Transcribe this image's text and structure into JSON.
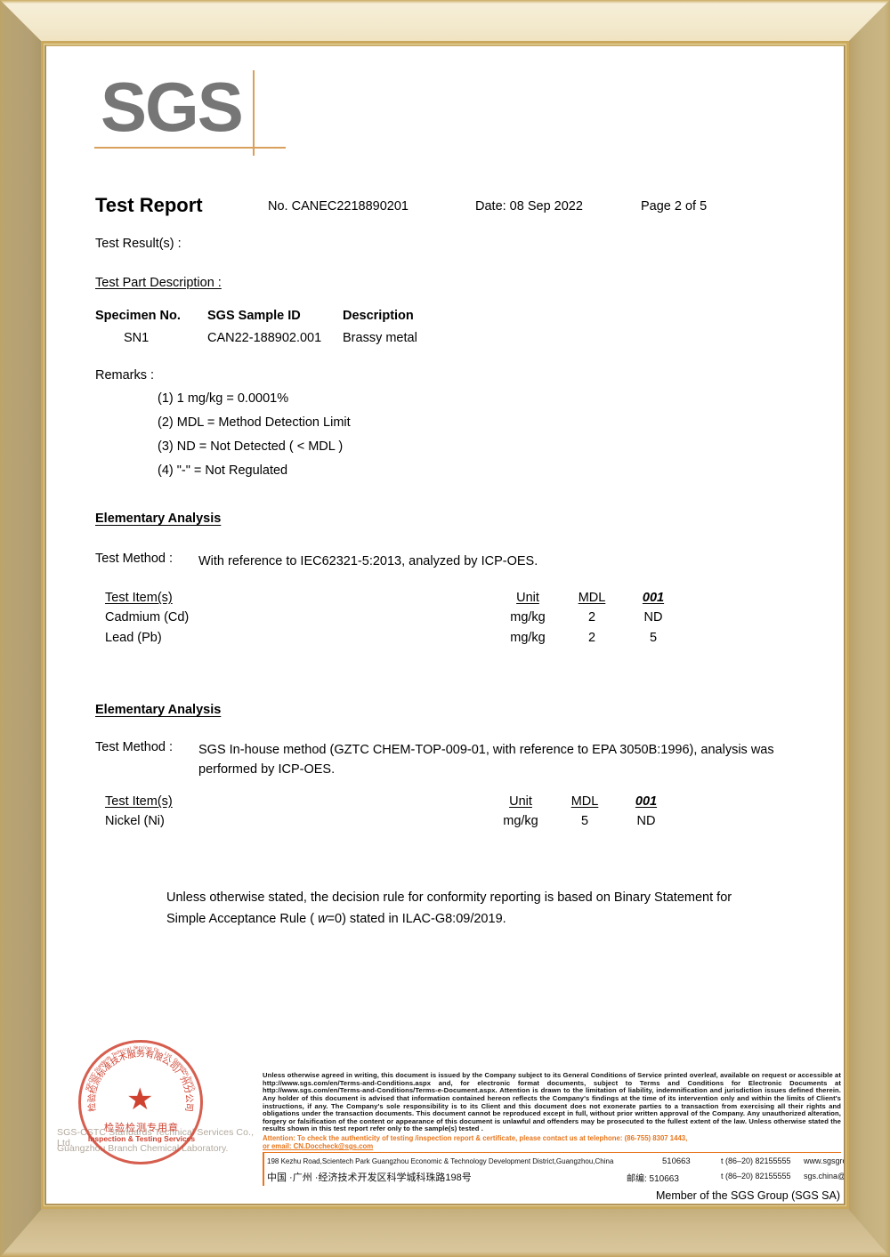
{
  "frame": {
    "outer_color": "#b9a474",
    "top_color": "#f3e9cd",
    "bevel_color": "#caa85c"
  },
  "logo": {
    "text": "SGS",
    "color": "#767676",
    "rule_color": "#d9a05c"
  },
  "header": {
    "title": "Test Report",
    "report_no": "No. CANEC2218890201",
    "date": "Date: 08 Sep 2022",
    "page": "Page 2 of 5"
  },
  "test_results_label": "Test Result(s) :",
  "test_part": {
    "heading": "Test Part Description :",
    "columns": [
      "Specimen No.",
      "SGS Sample ID",
      "Description"
    ],
    "rows": [
      {
        "specimen_no": "SN1",
        "sample_id": "CAN22-188902.001",
        "description": "Brassy metal"
      }
    ]
  },
  "remarks": {
    "label": "Remarks :",
    "items": [
      "(1) 1 mg/kg = 0.0001%",
      "(2) MDL = Method Detection Limit",
      "(3) ND = Not Detected ( < MDL )",
      "(4) \"-\" = Not Regulated"
    ]
  },
  "sections": [
    {
      "title": "Elementary Analysis",
      "method_label": "Test Method :",
      "method_text": "With reference to  IEC62321-5:2013, analyzed by ICP-OES.",
      "table": {
        "columns": [
          "Test Item(s)",
          "Unit",
          "MDL",
          "001"
        ],
        "rows": [
          {
            "item": "Cadmium (Cd)",
            "unit": "mg/kg",
            "mdl": "2",
            "v001": "ND"
          },
          {
            "item": "Lead (Pb)",
            "unit": "mg/kg",
            "mdl": "2",
            "v001": "5"
          }
        ]
      }
    },
    {
      "title": "Elementary Analysis",
      "method_label": "Test Method :",
      "method_text": "SGS In-house method (GZTC CHEM-TOP-009-01, with reference to EPA 3050B:1996), analysis was performed by ICP-OES.",
      "table": {
        "columns": [
          "Test Item(s)",
          "Unit",
          "MDL",
          "001"
        ],
        "rows": [
          {
            "item": "Nickel (Ni)",
            "unit": "mg/kg",
            "mdl": "5",
            "v001": "ND"
          }
        ]
      }
    }
  ],
  "decision_note": {
    "line1": "Unless otherwise stated, the decision rule for conformity reporting is based on Binary Statement for",
    "line2_pre": "Simple Acceptance Rule ( ",
    "line2_italic": "w",
    "line2_post": "=0) stated in ILAC-G8:09/2019."
  },
  "footer": {
    "stamp": {
      "arc_text_top": "检验检测标准技术服务有限公司广州分公司",
      "arc_text_bottom": "SGS-CSTC Standards Technical Services Co., Ltd. Guangzhou Branch",
      "center_cn": "检验检测专用章",
      "center_en": "Inspection & Testing Services",
      "star": "★",
      "color": "#cf4230"
    },
    "watermark_line1": "SGS-CSTC Standards Technical Services Co., Ltd.",
    "watermark_line2": "Guangzhou Branch      Chemical Laboratory.",
    "fineprint": "Unless otherwise agreed in writing, this document is issued by the Company subject to its General Conditions of Service printed overleaf, available on request or accessible at http://www.sgs.com/en/Terms-and-Conditions.aspx and, for electronic format documents, subject to Terms and Conditions for Electronic Documents at http://www.sgs.com/en/Terms-and-Conditions/Terms-e-Document.aspx. Attention is drawn to the limitation of liability, indemnification and jurisdiction issues defined therein. Any holder of this document is advised that information contained hereon reflects the Company's findings at the time of its intervention only and within the limits of Client's instructions, if any. The Company's sole responsibility is to its Client and this document does not exonerate parties to a transaction from exercising all their rights and obligations under the transaction documents. This document cannot be reproduced except in full, without prior written approval of the Company. Any unauthorized alteration, forgery or falsification of the content or appearance of this document is unlawful and offenders may be prosecuted to the fullest extent of the law. Unless otherwise stated the results shown in this test report refer only to the sample(s) tested .",
    "attention_line1": "Attention: To check the authenticity of testing /inspection report & certificate, please contact us at telephone: (86-755) 8307 1443,",
    "attention_line2": "or email: CN.Doccheck@sgs.com",
    "address_en": "198 Kezhu Road,Scientech Park Guangzhou Economic & Technology Development District,Guangzhou,China",
    "zip_en": "510663",
    "tel_en": "t (86–20) 82155555",
    "web_en": "www.sgsgroup.com.cn",
    "address_cn": "中国 ·广州 ·经济技术开发区科学城科珠路198号",
    "zip_cn": "邮编: 510663",
    "tel_cn": "t (86–20) 82155555",
    "web_cn": "sgs.china@sgs.com",
    "member": "Member of the SGS Group (SGS SA)",
    "accent_color": "#e8761c"
  }
}
